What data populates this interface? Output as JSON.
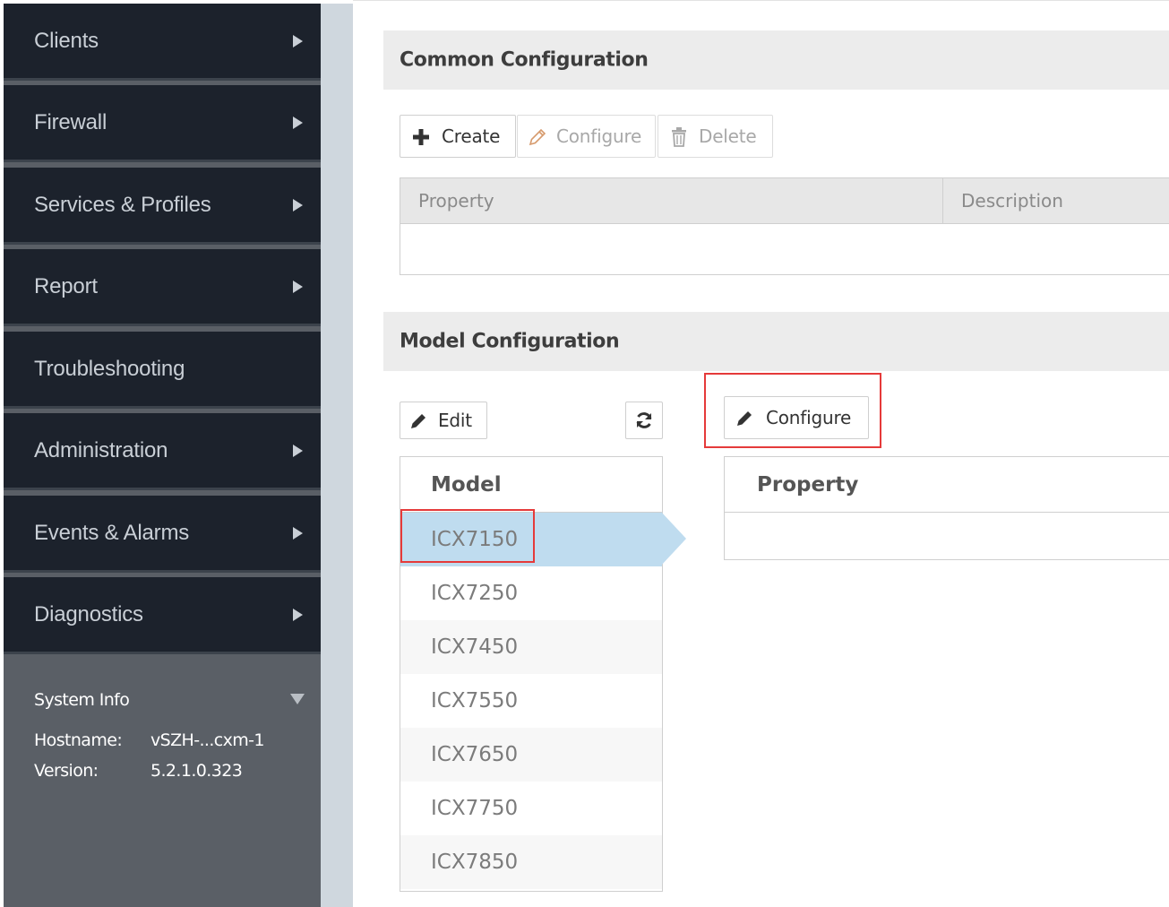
{
  "sidebar": {
    "items": [
      {
        "label": "Clients",
        "has_arrow": true
      },
      {
        "label": "Firewall",
        "has_arrow": true
      },
      {
        "label": "Services & Profiles",
        "has_arrow": true
      },
      {
        "label": "Report",
        "has_arrow": true
      },
      {
        "label": "Troubleshooting",
        "has_arrow": false
      },
      {
        "label": "Administration",
        "has_arrow": true
      },
      {
        "label": "Events & Alarms",
        "has_arrow": true
      },
      {
        "label": "Diagnostics",
        "has_arrow": true
      }
    ],
    "system_info": {
      "title": "System Info",
      "hostname_label": "Hostname:",
      "hostname_value": "vSZH-...cxm-1",
      "version_label": "Version:",
      "version_value": "5.2.1.0.323"
    }
  },
  "common_config": {
    "title": "Common Configuration",
    "toolbar": {
      "create_label": "Create",
      "configure_label": "Configure",
      "delete_label": "Delete"
    },
    "table": {
      "columns": [
        "Property",
        "Description"
      ]
    }
  },
  "model_config": {
    "title": "Model Configuration",
    "edit_label": "Edit",
    "configure_label": "Configure",
    "model_header": "Model",
    "models": [
      "ICX7150",
      "ICX7250",
      "ICX7450",
      "ICX7550",
      "ICX7650",
      "ICX7750",
      "ICX7850"
    ],
    "selected_model": "ICX7150",
    "property_header": "Property"
  },
  "colors": {
    "sidebar_bg": "#1c222c",
    "sidebar_text": "#c9cfd6",
    "selection": "#bfdcef",
    "highlight_red": "#e53a3a"
  }
}
